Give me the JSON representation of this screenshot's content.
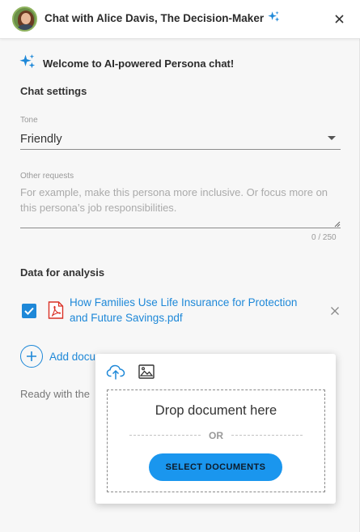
{
  "header": {
    "title": "Chat with Alice Davis, The Decision-Maker",
    "avatar_icon": "avatar-photo",
    "sparkle_icon": "sparkle-icon",
    "close_icon": "close-icon"
  },
  "welcome": {
    "text": "Welcome to AI-powered Persona chat!"
  },
  "chat_settings": {
    "title": "Chat settings",
    "tone_label": "Tone",
    "tone_value": "Friendly",
    "other_requests_label": "Other requests",
    "other_requests_placeholder": "For example, make this persona more inclusive. Or focus more on this persona’s job responsibilities.",
    "other_requests_value": "",
    "counter": "0 / 250"
  },
  "data_analysis": {
    "title": "Data for analysis",
    "document": {
      "checked": true,
      "name": "How Families Use Life Insurance for Protection and Future Savings.pdf"
    },
    "add_label": "Add docu",
    "status": "Ready with the"
  },
  "upload_popup": {
    "drop_text": "Drop document here",
    "or_text": "OR",
    "button_label": "SELECT DOCUMENTS"
  },
  "colors": {
    "accent": "#1e88d8",
    "button": "#1a96ee",
    "pdf_red": "#d93025"
  }
}
